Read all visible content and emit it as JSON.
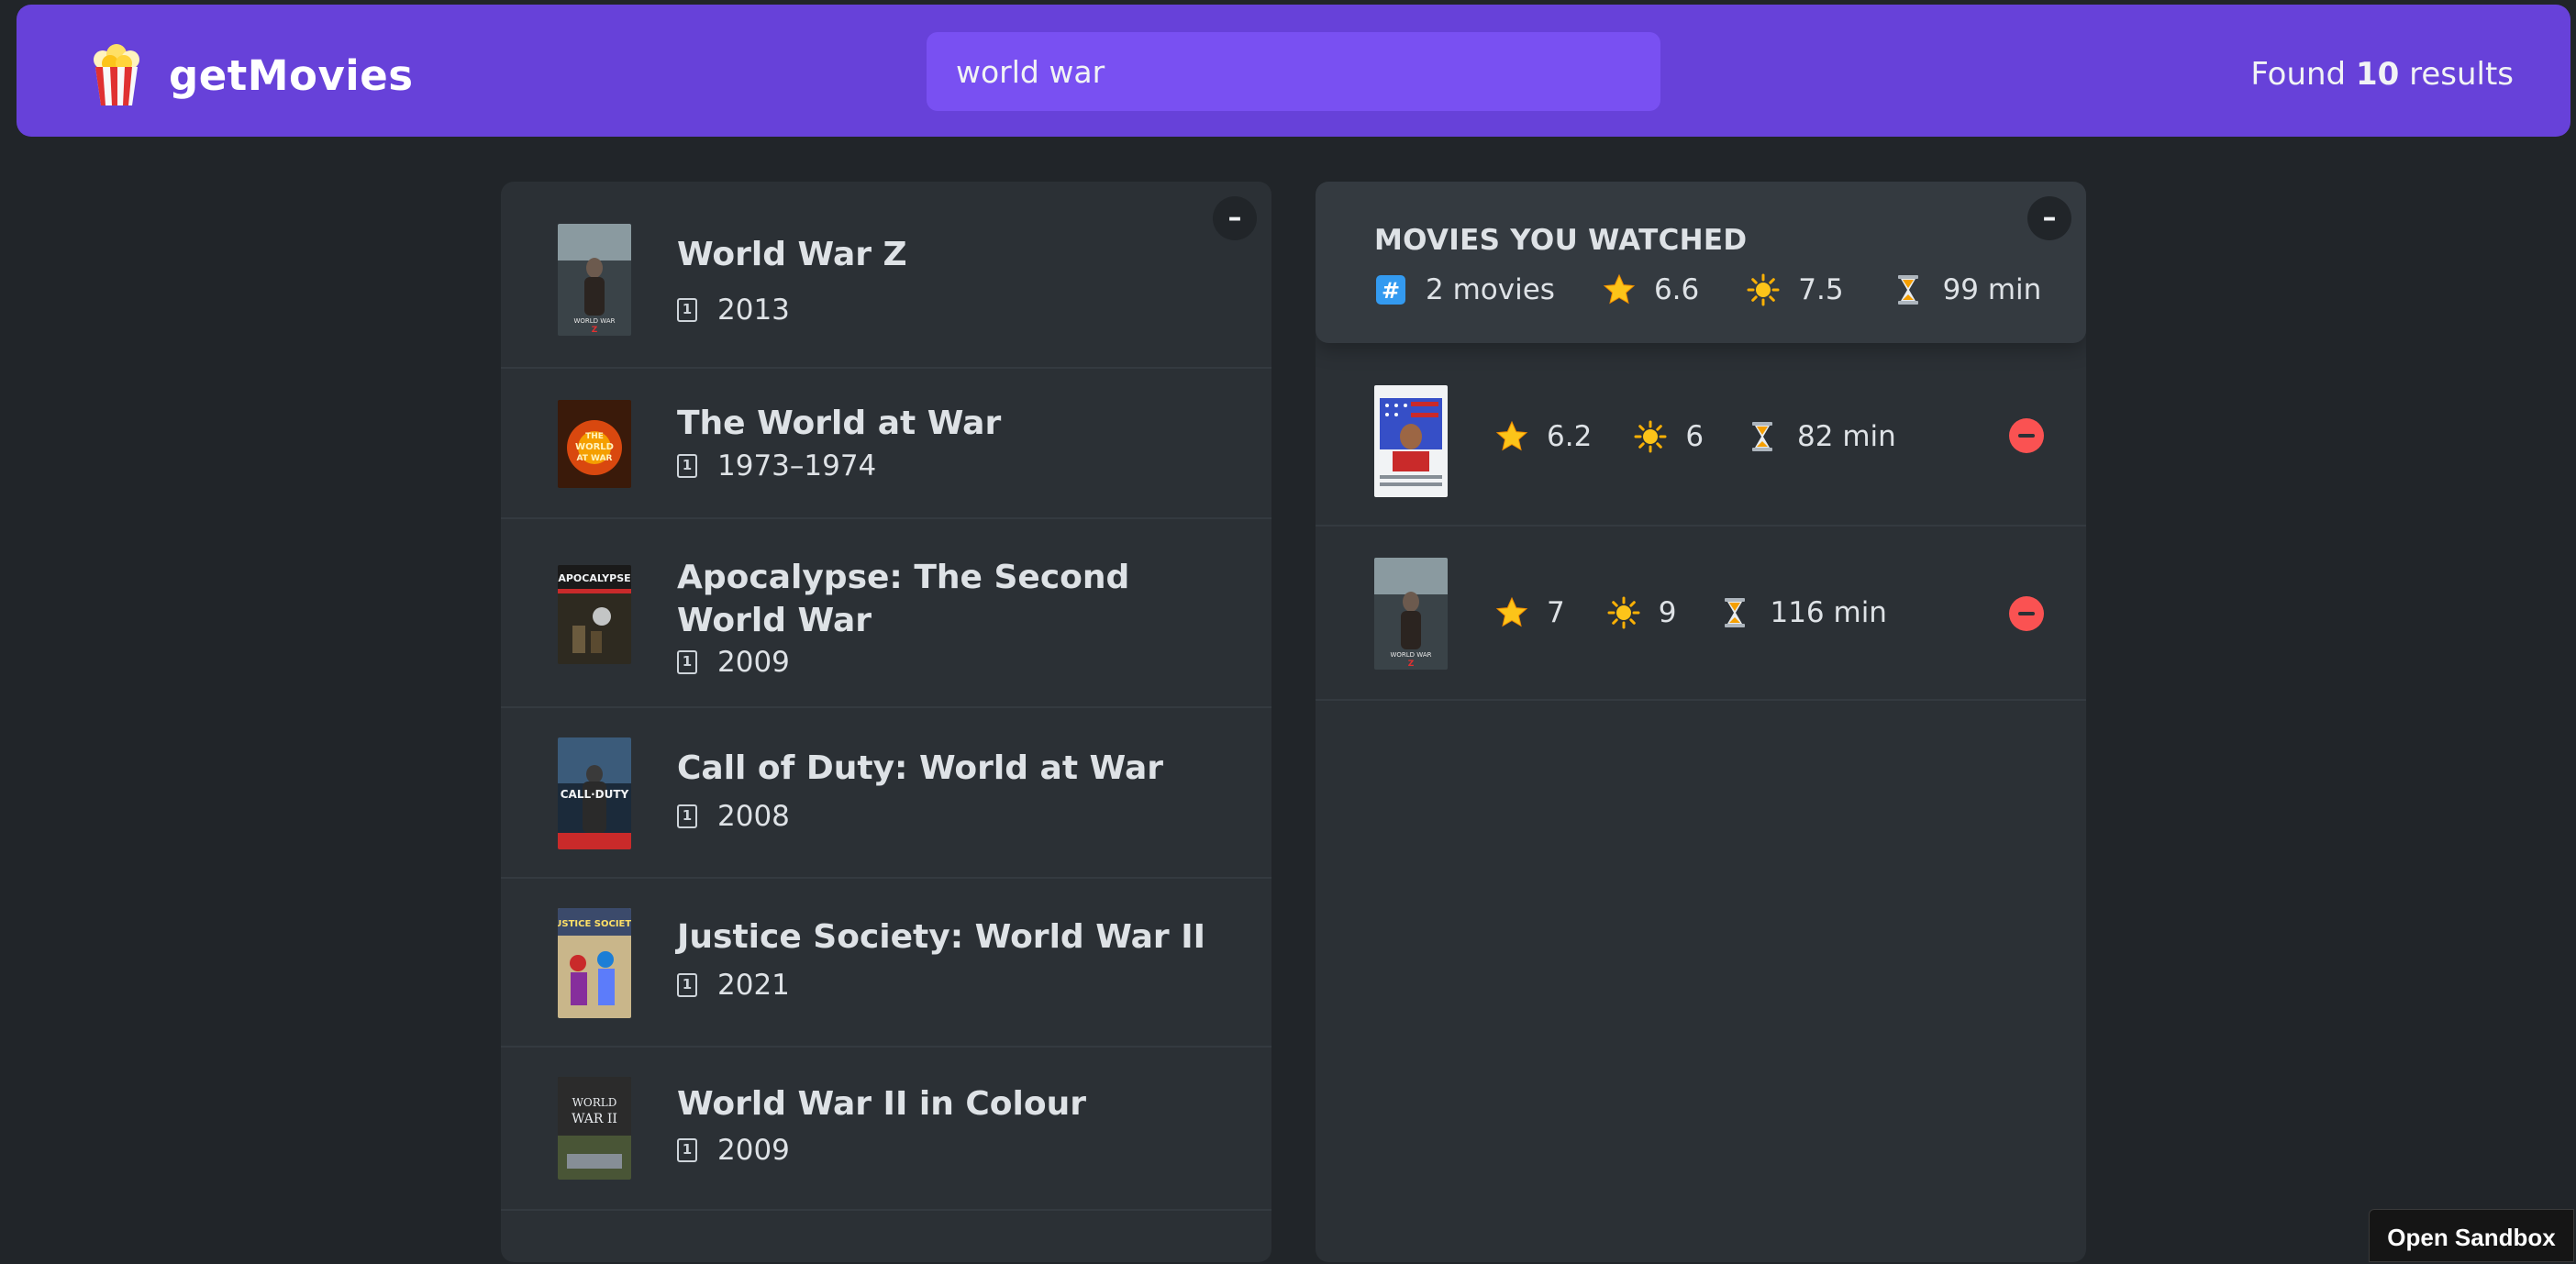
{
  "navbar": {
    "logo_icon": "popcorn-icon",
    "logo_text": "getMovies",
    "search_value": "world war",
    "results_prefix": "Found ",
    "results_count": "10",
    "results_suffix": " results",
    "brand_color": "#6741d9",
    "search_bg": "#7950f2"
  },
  "search_list": {
    "toggle_label": "–",
    "movies": [
      {
        "title": "World War Z",
        "year": "2013",
        "poster_icon": "poster-world-war-z"
      },
      {
        "title": "The World at War",
        "year": "1973–1974",
        "poster_icon": "poster-world-at-war"
      },
      {
        "title": "Apocalypse: The Second World War",
        "year": "2009",
        "poster_icon": "poster-apocalypse"
      },
      {
        "title": "Call of Duty: World at War",
        "year": "2008",
        "poster_icon": "poster-call-of-duty"
      },
      {
        "title": "Justice Society: World War II",
        "year": "2021",
        "poster_icon": "poster-justice-society"
      },
      {
        "title": "World War II in Colour",
        "year": "2009",
        "poster_icon": "poster-ww2-colour"
      }
    ],
    "year_icon": "calendar-icon"
  },
  "watched": {
    "toggle_label": "–",
    "summary": {
      "title": "MOVIES YOU WATCHED",
      "count": "2 movies",
      "imdb_avg": "6.6",
      "user_avg": "7.5",
      "runtime_avg": "99 min"
    },
    "movies": [
      {
        "poster_icon": "poster-patriot",
        "imdb": "6.2",
        "user": "6",
        "runtime": "82 min"
      },
      {
        "poster_icon": "poster-world-war-z",
        "imdb": "7",
        "user": "9",
        "runtime": "116 min"
      }
    ],
    "icons": {
      "count": "hash-icon",
      "imdb": "star-icon",
      "user": "sun-icon",
      "runtime": "hourglass-icon",
      "delete": "remove-icon"
    },
    "delete_color": "#fa5252"
  },
  "sandbox": {
    "label": "Open Sandbox"
  }
}
